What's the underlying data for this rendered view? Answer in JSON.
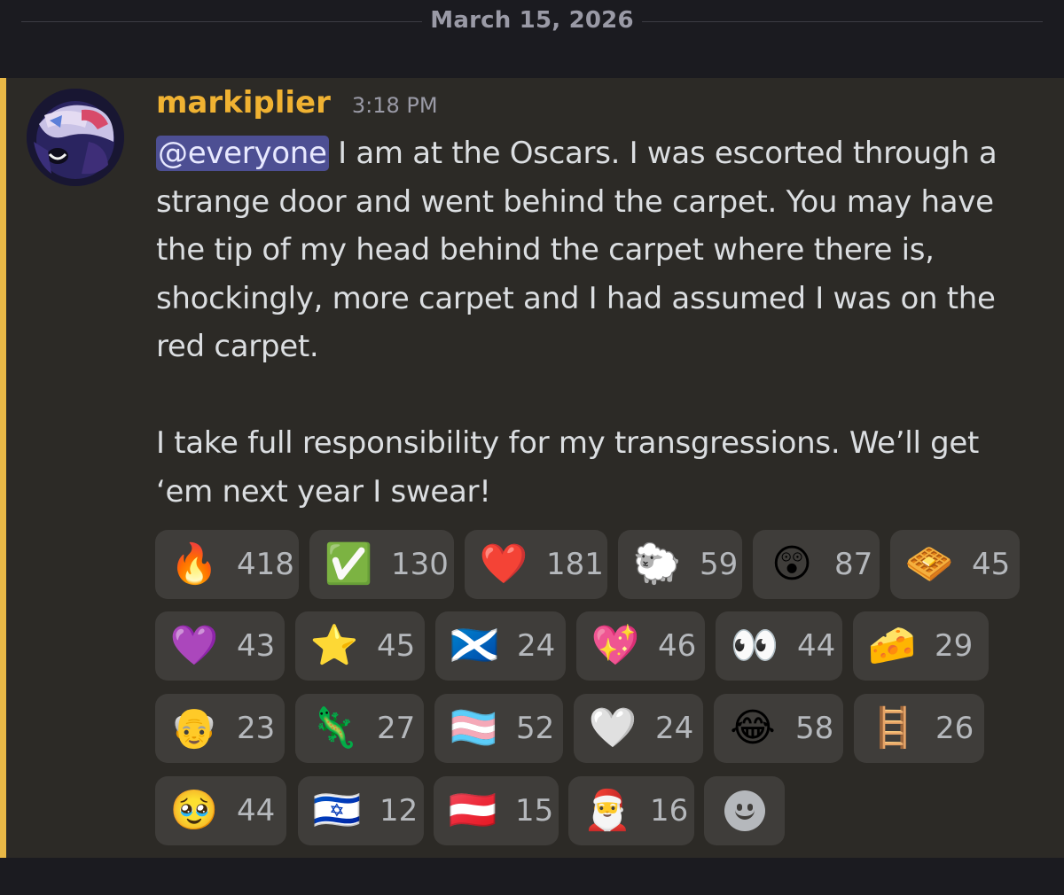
{
  "date_divider": {
    "text": "March 15, 2026"
  },
  "message": {
    "username": "markiplier",
    "timestamp": "3:18 PM",
    "mention": "@everyone",
    "paragraph1_rest": " I am at the Oscars. I was escorted through a strange door and went behind the carpet. You may have the tip of my head behind the carpet where there is, shockingly, more carpet and I had assumed I was on the red carpet.",
    "paragraph2": "I take full responsibility for my transgressions. We’ll get ‘em next year I swear!"
  },
  "reactions": [
    {
      "emoji": "🔥",
      "name": "fire",
      "count": "418"
    },
    {
      "emoji": "✅",
      "name": "white-check-mark",
      "count": "130"
    },
    {
      "emoji": "❤️",
      "name": "red-heart",
      "count": "181"
    },
    {
      "emoji": "🐑",
      "name": "sheep",
      "count": "59"
    },
    {
      "emoji": "😲",
      "name": "astonished-face",
      "count": "87"
    },
    {
      "emoji": "🧇",
      "name": "waffle",
      "count": "45"
    },
    {
      "emoji": "💜",
      "name": "purple-heart",
      "count": "43"
    },
    {
      "emoji": "⭐",
      "name": "star",
      "count": "45"
    },
    {
      "emoji": "🏴󠁧󠁢󠁳󠁣󠁴󠁿",
      "name": "scotland-flag",
      "count": "24"
    },
    {
      "emoji": "💖",
      "name": "sparkling-heart",
      "count": "46"
    },
    {
      "emoji": "👀",
      "name": "eyes",
      "count": "44"
    },
    {
      "emoji": "🧀",
      "name": "cheese",
      "count": "29"
    },
    {
      "emoji": "👴",
      "name": "old-man",
      "count": "23"
    },
    {
      "emoji": "🦎",
      "name": "lizard",
      "count": "27"
    },
    {
      "emoji": "🏳️‍⚧️",
      "name": "transgender-flag",
      "count": "52"
    },
    {
      "emoji": "🤍",
      "name": "white-heart",
      "count": "24"
    },
    {
      "emoji": "😂",
      "name": "tears-of-joy",
      "count": "58"
    },
    {
      "emoji": "🪜",
      "name": "ladder",
      "count": "26"
    },
    {
      "emoji": "🥹",
      "name": "holding-back-tears",
      "count": "44"
    },
    {
      "emoji": "🇮🇱",
      "name": "israel-flag",
      "count": "12"
    },
    {
      "emoji": "🇦🇹",
      "name": "austria-flag",
      "count": "15"
    },
    {
      "emoji": "🎅",
      "name": "santa",
      "count": "16"
    }
  ],
  "add_reaction": {
    "icon": "smile-icon"
  },
  "colors": {
    "username": "#f0b232",
    "mention_highlight": "#4d4f93",
    "mention_bar": "#e9b846",
    "message_bg": "#2c2a26",
    "reaction_bg": "#3f3d3a"
  }
}
